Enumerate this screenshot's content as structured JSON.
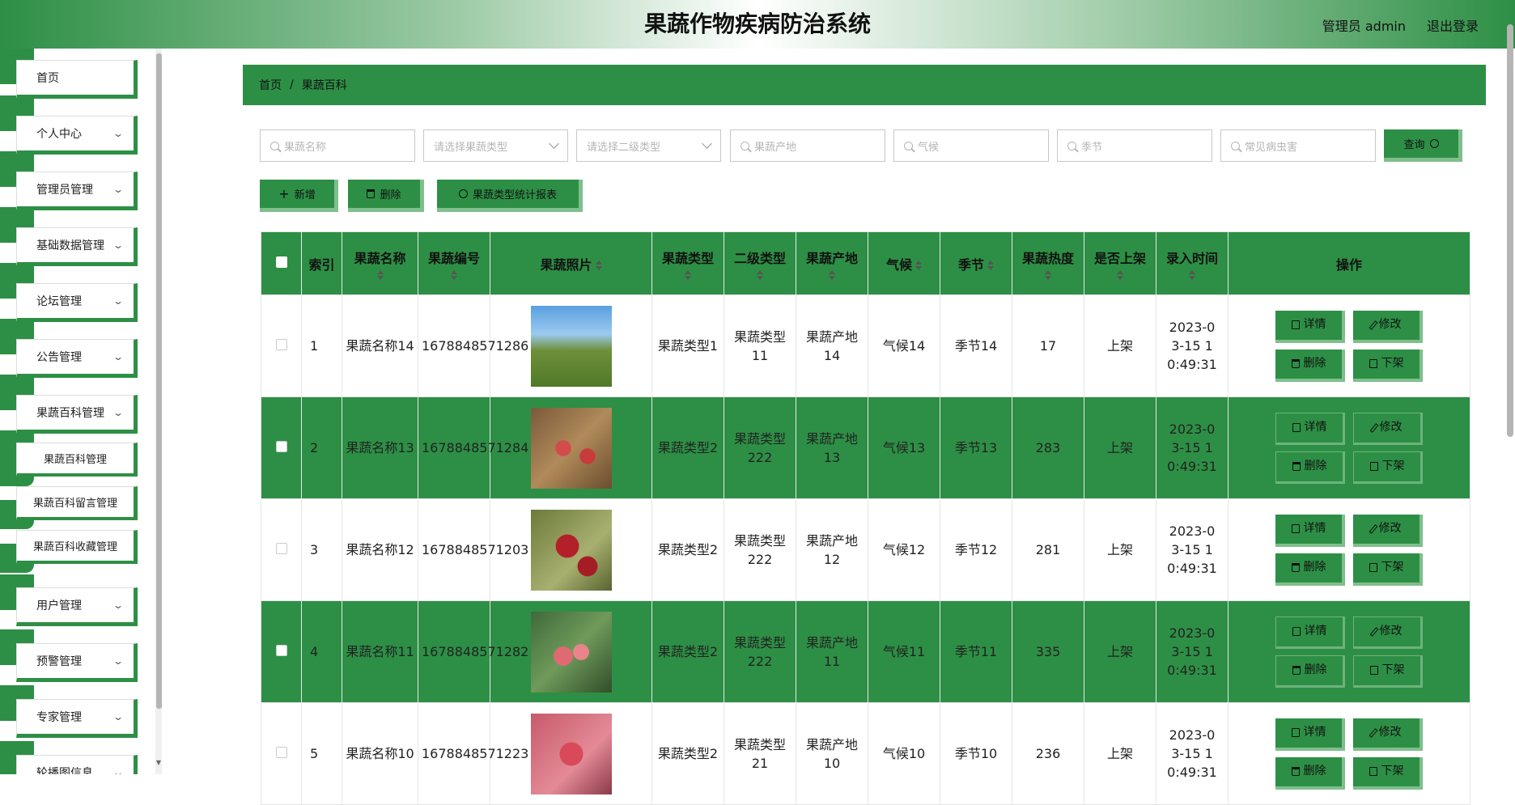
{
  "header": {
    "title": "果蔬作物疾病防治系统",
    "user": "管理员 admin",
    "logout": "退出登录"
  },
  "sidebar": {
    "items": [
      {
        "label": "首页"
      },
      {
        "label": "个人中心"
      },
      {
        "label": "管理员管理"
      },
      {
        "label": "基础数据管理"
      },
      {
        "label": "论坛管理"
      },
      {
        "label": "公告管理"
      },
      {
        "label": "果蔬百科管理"
      },
      {
        "label": "用户管理"
      },
      {
        "label": "预警管理"
      },
      {
        "label": "专家管理"
      },
      {
        "label": "轮播图信息"
      }
    ],
    "subitems": [
      {
        "label": "果蔬百科管理"
      },
      {
        "label": "果蔬百科留言管理"
      },
      {
        "label": "果蔬百科收藏管理"
      }
    ]
  },
  "breadcrumb": {
    "home": "首页",
    "sep": "/",
    "current": "果蔬百科"
  },
  "search": {
    "name": "果蔬名称",
    "type": "请选择果蔬类型",
    "subtype": "请选择二级类型",
    "origin": "果蔬产地",
    "climate": "气候",
    "season": "季节",
    "pest": "常见病虫害",
    "query": "查询"
  },
  "actions": {
    "add": "新增",
    "delete": "删除",
    "report": "果蔬类型统计报表"
  },
  "table": {
    "headers": [
      "索引",
      "果蔬名称",
      "果蔬编号",
      "果蔬照片",
      "果蔬类型",
      "二级类型",
      "果蔬产地",
      "气候",
      "季节",
      "果蔬热度",
      "是否上架",
      "录入时间",
      "操作"
    ],
    "ops": {
      "detail": "详情",
      "edit": "修改",
      "delete": "删除",
      "offshelf": "下架"
    },
    "rows": [
      {
        "index": "1",
        "name": "果蔬名称14",
        "code": "1678848571286",
        "type": "果蔬类型1",
        "subtype": "果蔬类型11",
        "origin": "果蔬产地14",
        "climate": "气候14",
        "season": "季节14",
        "heat": "17",
        "onshelf": "上架",
        "time": "2023-03-15 10:49:31"
      },
      {
        "index": "2",
        "name": "果蔬名称13",
        "code": "1678848571284",
        "type": "果蔬类型2",
        "subtype": "果蔬类型222",
        "origin": "果蔬产地13",
        "climate": "气候13",
        "season": "季节13",
        "heat": "283",
        "onshelf": "上架",
        "time": "2023-03-15 10:49:31"
      },
      {
        "index": "3",
        "name": "果蔬名称12",
        "code": "1678848571203",
        "type": "果蔬类型2",
        "subtype": "果蔬类型222",
        "origin": "果蔬产地12",
        "climate": "气候12",
        "season": "季节12",
        "heat": "281",
        "onshelf": "上架",
        "time": "2023-03-15 10:49:31"
      },
      {
        "index": "4",
        "name": "果蔬名称11",
        "code": "1678848571282",
        "type": "果蔬类型2",
        "subtype": "果蔬类型222",
        "origin": "果蔬产地11",
        "climate": "气候11",
        "season": "季节11",
        "heat": "335",
        "onshelf": "上架",
        "time": "2023-03-15 10:49:31"
      },
      {
        "index": "5",
        "name": "果蔬名称10",
        "code": "1678848571223",
        "type": "果蔬类型2",
        "subtype": "果蔬类型21",
        "origin": "果蔬产地10",
        "climate": "气候10",
        "season": "季节10",
        "heat": "236",
        "onshelf": "上架",
        "time": "2023-03-15 10:49:31"
      }
    ]
  },
  "colors": {
    "primary": "#2d8f45",
    "accent": "#7fbf8c"
  }
}
